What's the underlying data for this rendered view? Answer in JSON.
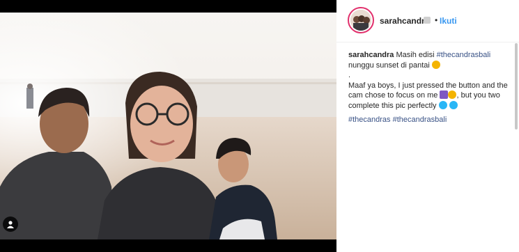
{
  "media": {
    "user_tag_icon": "person-icon",
    "colors": {
      "sky": "#f5f2ee",
      "sea": "#e9e6e2",
      "sand": "#d9c9b9"
    }
  },
  "header": {
    "username": "sarahcandra",
    "separator": "•",
    "follow_label": "Ikuti",
    "follow_color": "#3897f0",
    "avatar_ring_color": "#e1306c"
  },
  "caption": {
    "username": "sarahcandra",
    "line1_text": "Masih edisi ",
    "hashtag1": "#thecandrasbali",
    "line2_text": "nunggu sunset di pantai",
    "dot": ".",
    "line3_text": "Maaf ya boys, I just pressed the button and the cam chose to focus on me",
    "line3_tail": ", but you two complete this pic perfectly",
    "hashtag2": "#thecandras",
    "hashtag3": "#thecandrasbali",
    "hashtag_color": "#385185"
  }
}
